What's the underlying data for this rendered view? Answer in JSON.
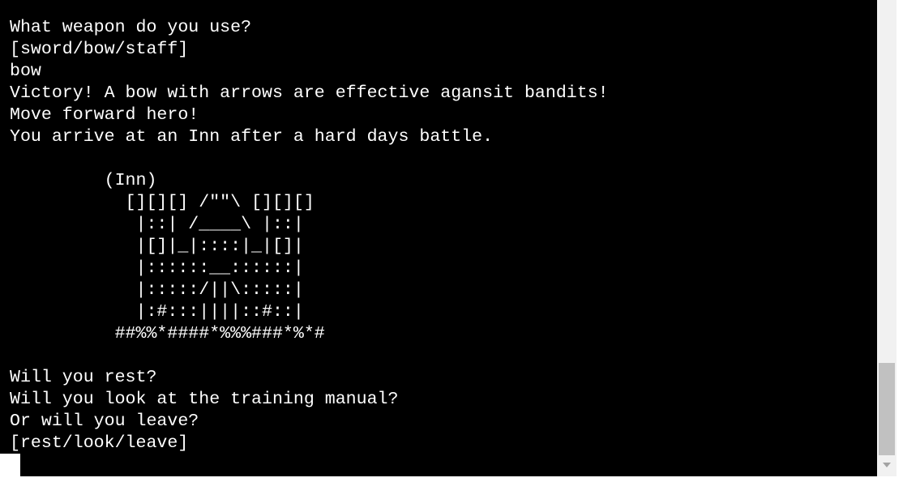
{
  "terminal": {
    "lines": [
      "What weapon do you use?",
      "[sword/bow/staff]",
      "bow",
      "Victory! A bow with arrows are effective agansit bandits!",
      "Move forward hero!",
      "You arrive at an Inn after a hard days battle.",
      "",
      "         (Inn)",
      "           [][][] /\"\"\\ [][][]",
      "            |::| /____\\ |::|",
      "            |[]|_|::::|_|[]|",
      "            |::::::__::::::|",
      "            |:::::/||\\:::::|",
      "            |:#:::||||::#::|",
      "          ##%%*####*%%%###*%*#",
      "",
      "Will you rest?",
      "Will you look at the training manual?",
      "Or will you leave?",
      "[rest/look/leave]"
    ]
  },
  "scrollbar": {
    "down_arrow_icon": "chevron-down-icon",
    "track_color": "#f1f1f1",
    "thumb_color": "#c1c1c1"
  },
  "colors": {
    "terminal_background": "#000000",
    "terminal_text": "#ffffff"
  }
}
